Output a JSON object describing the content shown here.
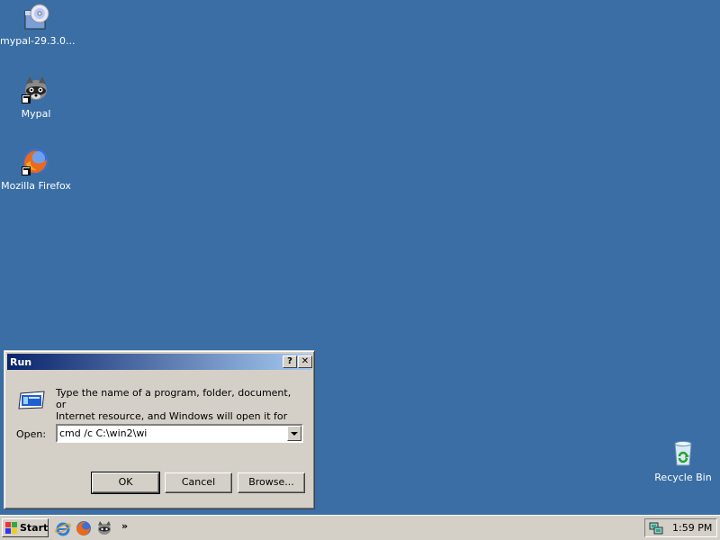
{
  "desktop": {
    "icons": [
      {
        "label": "mypal-29.3.0...",
        "icon": "installer-cd-icon"
      },
      {
        "label": "Mypal",
        "icon": "raccoon-icon"
      },
      {
        "label": "Mozilla Firefox",
        "icon": "firefox-icon"
      },
      {
        "label": "Recycle Bin",
        "icon": "recycle-bin-icon"
      }
    ]
  },
  "run_dialog": {
    "title": "Run",
    "help_button": "?",
    "close_button": "✕",
    "prompt_line1": "Type the name of a program, folder, document, or",
    "prompt_line2": "Internet resource, and Windows will open it for you.",
    "open_label": "Open:",
    "command_value": "cmd /c C:\\win2\\wi",
    "ok_label": "OK",
    "cancel_label": "Cancel",
    "browse_label": "Browse..."
  },
  "taskbar": {
    "start_label": "Start",
    "quick_launch": [
      "internet-explorer-icon",
      "firefox-icon",
      "raccoon-icon"
    ],
    "chevron": "»",
    "clock": "1:59 PM"
  },
  "colors": {
    "desktop": "#3a6ea5",
    "title_start": "#0a246a",
    "title_end": "#a6caf0",
    "face": "#d4d0c8"
  }
}
